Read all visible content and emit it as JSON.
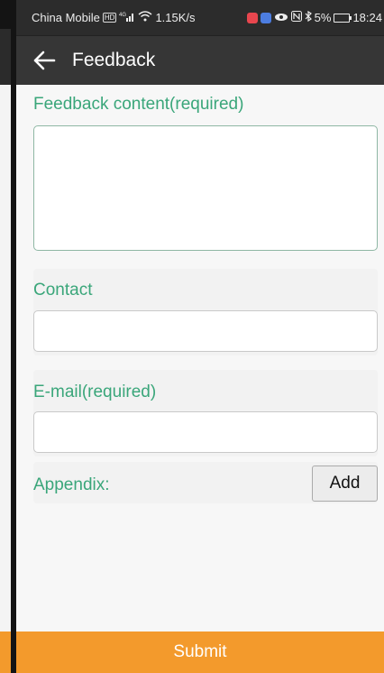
{
  "status_bar": {
    "carrier": "China Mobile",
    "hd_badge": "HD",
    "network_type": "4G",
    "network_speed": "1.15K/s",
    "battery": "5%",
    "time": "18:24"
  },
  "app_bar": {
    "title": "Feedback",
    "back_icon": "arrow-left-icon"
  },
  "form": {
    "feedback_label": "Feedback content(required)",
    "feedback_value": "",
    "contact_label": "Contact",
    "contact_value": "",
    "email_label": "E-mail(required)",
    "email_value": "",
    "appendix_label": "Appendix:",
    "add_button_label": "Add"
  },
  "submit_label": "Submit",
  "colors": {
    "accent_green": "#3aa67a",
    "submit_orange": "#f39a2c",
    "app_bar": "#363636",
    "status_bar": "#2c2c2c"
  }
}
